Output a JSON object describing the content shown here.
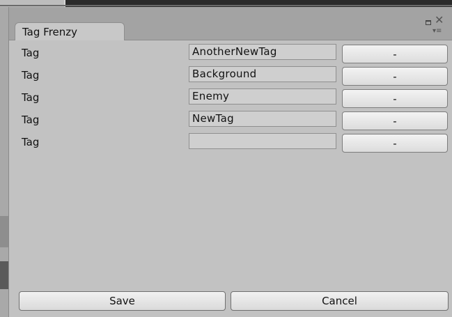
{
  "window": {
    "tab_title": "Tag Frenzy"
  },
  "rows": [
    {
      "label": "Tag",
      "value": "AnotherNewTag",
      "remove_label": "-"
    },
    {
      "label": "Tag",
      "value": "Background",
      "remove_label": "-"
    },
    {
      "label": "Tag",
      "value": "Enemy",
      "remove_label": "-"
    },
    {
      "label": "Tag",
      "value": "NewTag",
      "remove_label": "-"
    },
    {
      "label": "Tag",
      "value": "",
      "remove_label": "-"
    }
  ],
  "footer": {
    "save_label": "Save",
    "cancel_label": "Cancel"
  },
  "icons": [
    "maximize-icon",
    "close-icon",
    "menu-icon"
  ]
}
